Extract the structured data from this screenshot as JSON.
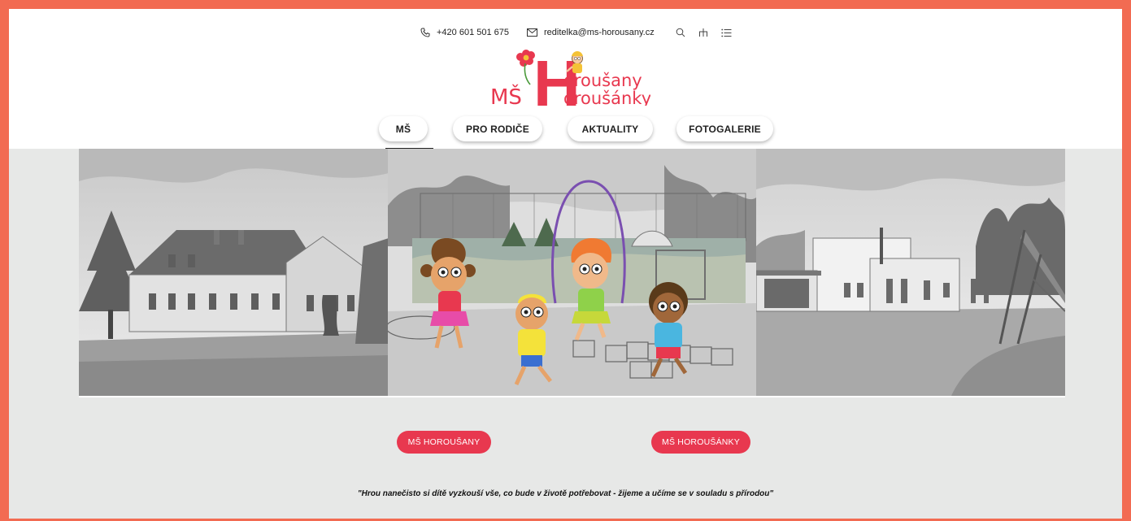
{
  "topbar": {
    "phone": "+420 601 501 675",
    "email": "reditelka@ms-horousany.cz",
    "icons": [
      "phone-icon",
      "mail-icon",
      "search-icon",
      "sitemap-icon",
      "list-icon"
    ]
  },
  "logo": {
    "prefix": "MŠ",
    "letter": "H",
    "line1": "oroušany",
    "line2": "oroušánky"
  },
  "nav": {
    "items": [
      {
        "label": "MŠ",
        "active": true
      },
      {
        "label": "PRO RODIČE",
        "active": false
      },
      {
        "label": "AKTUALITY",
        "active": false
      },
      {
        "label": "FOTOGALERIE",
        "active": false
      }
    ]
  },
  "buttons": {
    "left": "MŠ HOROUŠANY",
    "right": "MŠ HOROUŠÁNKY"
  },
  "quote": "\"Hrou nanečisto si dítě vyzkouší vše, co bude v životě potřebovat - žijeme a učíme se v souladu s přírodou\"",
  "colors": {
    "frame": "#f26b52",
    "accent": "#e8384f",
    "background": "#e7e8e7"
  }
}
